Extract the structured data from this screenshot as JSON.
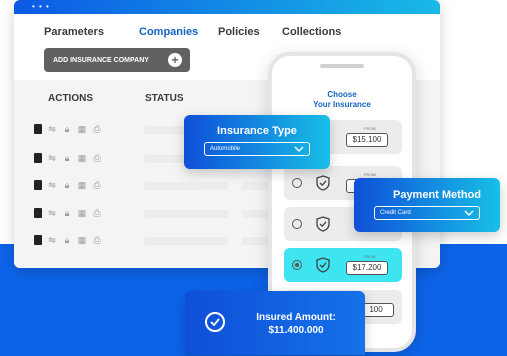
{
  "window": {
    "dots": "• • •",
    "tabs": [
      {
        "label": "Parameters"
      },
      {
        "label": "Companies"
      },
      {
        "label": "Policies"
      },
      {
        "label": "Collections"
      }
    ],
    "add_button_label": "ADD INSURANCE COMPANY",
    "columns": {
      "actions": "ACTIONS",
      "status": "STATUS"
    }
  },
  "phone": {
    "title_line1": "Choose",
    "title_line2": "Your Insurance",
    "options": [
      {
        "from": "FROM",
        "price": "$15.100",
        "selected": false
      },
      {
        "from": "FROM",
        "price": "$1",
        "selected": false
      },
      {
        "from": "",
        "price": "",
        "selected": false
      },
      {
        "from": "FROM",
        "price": "$17.200",
        "selected": true
      },
      {
        "from": "",
        "price": "100",
        "selected": false
      }
    ]
  },
  "insurance_type": {
    "title": "Insurance Type",
    "value": "Automobile"
  },
  "payment_method": {
    "title": "Payment Method",
    "value": "Credit Card"
  },
  "insured_amount": {
    "label": "Insured Amount:",
    "value": "$11.400.000"
  },
  "icons": [
    "document-icon",
    "swap-icon",
    "lock-icon",
    "calendar-icon",
    "print-icon",
    "shield-check-icon",
    "check-circle-icon",
    "chevron-down-icon",
    "plus-icon"
  ],
  "colors": {
    "brand_blue": "#0d63e8",
    "accent_cyan": "#3ee5f0",
    "button_gray": "#616161"
  }
}
